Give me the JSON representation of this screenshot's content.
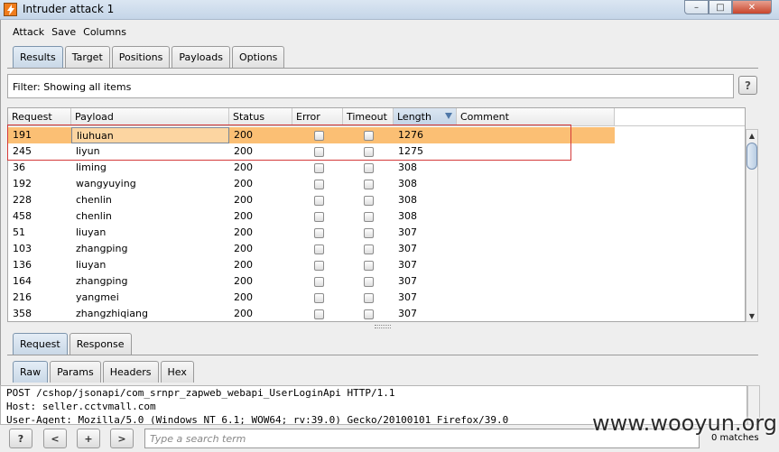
{
  "window": {
    "title": "Intruder attack 1",
    "controls": {
      "minimize": "–",
      "maximize": "□",
      "close": "✕"
    }
  },
  "menu": [
    "Attack",
    "Save",
    "Columns"
  ],
  "main_tabs": [
    {
      "label": "Results",
      "active": true
    },
    {
      "label": "Target",
      "active": false
    },
    {
      "label": "Positions",
      "active": false
    },
    {
      "label": "Payloads",
      "active": false
    },
    {
      "label": "Options",
      "active": false
    }
  ],
  "filter": {
    "text": "Filter: Showing all items",
    "help_label": "?"
  },
  "table": {
    "columns": [
      "Request",
      "Payload",
      "Status",
      "Error",
      "Timeout",
      "Length",
      "Comment"
    ],
    "sorted_column": "Length",
    "rows": [
      {
        "request": "191",
        "payload": "liuhuan",
        "status": "200",
        "error": false,
        "timeout": false,
        "length": "1276",
        "comment": "",
        "selected": true
      },
      {
        "request": "245",
        "payload": "liyun",
        "status": "200",
        "error": false,
        "timeout": false,
        "length": "1275",
        "comment": "",
        "selected": false
      },
      {
        "request": "36",
        "payload": "liming",
        "status": "200",
        "error": false,
        "timeout": false,
        "length": "308",
        "comment": "",
        "selected": false
      },
      {
        "request": "192",
        "payload": "wangyuying",
        "status": "200",
        "error": false,
        "timeout": false,
        "length": "308",
        "comment": "",
        "selected": false
      },
      {
        "request": "228",
        "payload": "chenlin",
        "status": "200",
        "error": false,
        "timeout": false,
        "length": "308",
        "comment": "",
        "selected": false
      },
      {
        "request": "458",
        "payload": "chenlin",
        "status": "200",
        "error": false,
        "timeout": false,
        "length": "308",
        "comment": "",
        "selected": false
      },
      {
        "request": "51",
        "payload": "liuyan",
        "status": "200",
        "error": false,
        "timeout": false,
        "length": "307",
        "comment": "",
        "selected": false
      },
      {
        "request": "103",
        "payload": "zhangping",
        "status": "200",
        "error": false,
        "timeout": false,
        "length": "307",
        "comment": "",
        "selected": false
      },
      {
        "request": "136",
        "payload": "liuyan",
        "status": "200",
        "error": false,
        "timeout": false,
        "length": "307",
        "comment": "",
        "selected": false
      },
      {
        "request": "164",
        "payload": "zhangping",
        "status": "200",
        "error": false,
        "timeout": false,
        "length": "307",
        "comment": "",
        "selected": false
      },
      {
        "request": "216",
        "payload": "yangmei",
        "status": "200",
        "error": false,
        "timeout": false,
        "length": "307",
        "comment": "",
        "selected": false
      },
      {
        "request": "358",
        "payload": "zhangzhiqiang",
        "status": "200",
        "error": false,
        "timeout": false,
        "length": "307",
        "comment": "",
        "selected": false
      }
    ]
  },
  "detail_tabs": [
    {
      "label": "Request",
      "active": true
    },
    {
      "label": "Response",
      "active": false
    }
  ],
  "view_tabs": [
    {
      "label": "Raw",
      "active": true
    },
    {
      "label": "Params",
      "active": false
    },
    {
      "label": "Headers",
      "active": false
    },
    {
      "label": "Hex",
      "active": false
    }
  ],
  "raw_lines": [
    "POST /cshop/jsonapi/com_srnpr_zapweb_webapi_UserLoginApi HTTP/1.1",
    "Host: seller.cctvmall.com",
    "User-Agent: Mozilla/5.0 (Windows NT 6.1; WOW64; rv:39.0) Gecko/20100101 Firefox/39.0"
  ],
  "bottom": {
    "buttons": [
      "?",
      "<",
      "+",
      ">"
    ],
    "search_placeholder": "Type a search term",
    "matches": "0 matches"
  },
  "watermark": "www.wooyun.org",
  "colors": {
    "selected_row": "#fbbf74",
    "highlight_box": "#d43a3a",
    "active_tab": "#c9d8e7"
  }
}
